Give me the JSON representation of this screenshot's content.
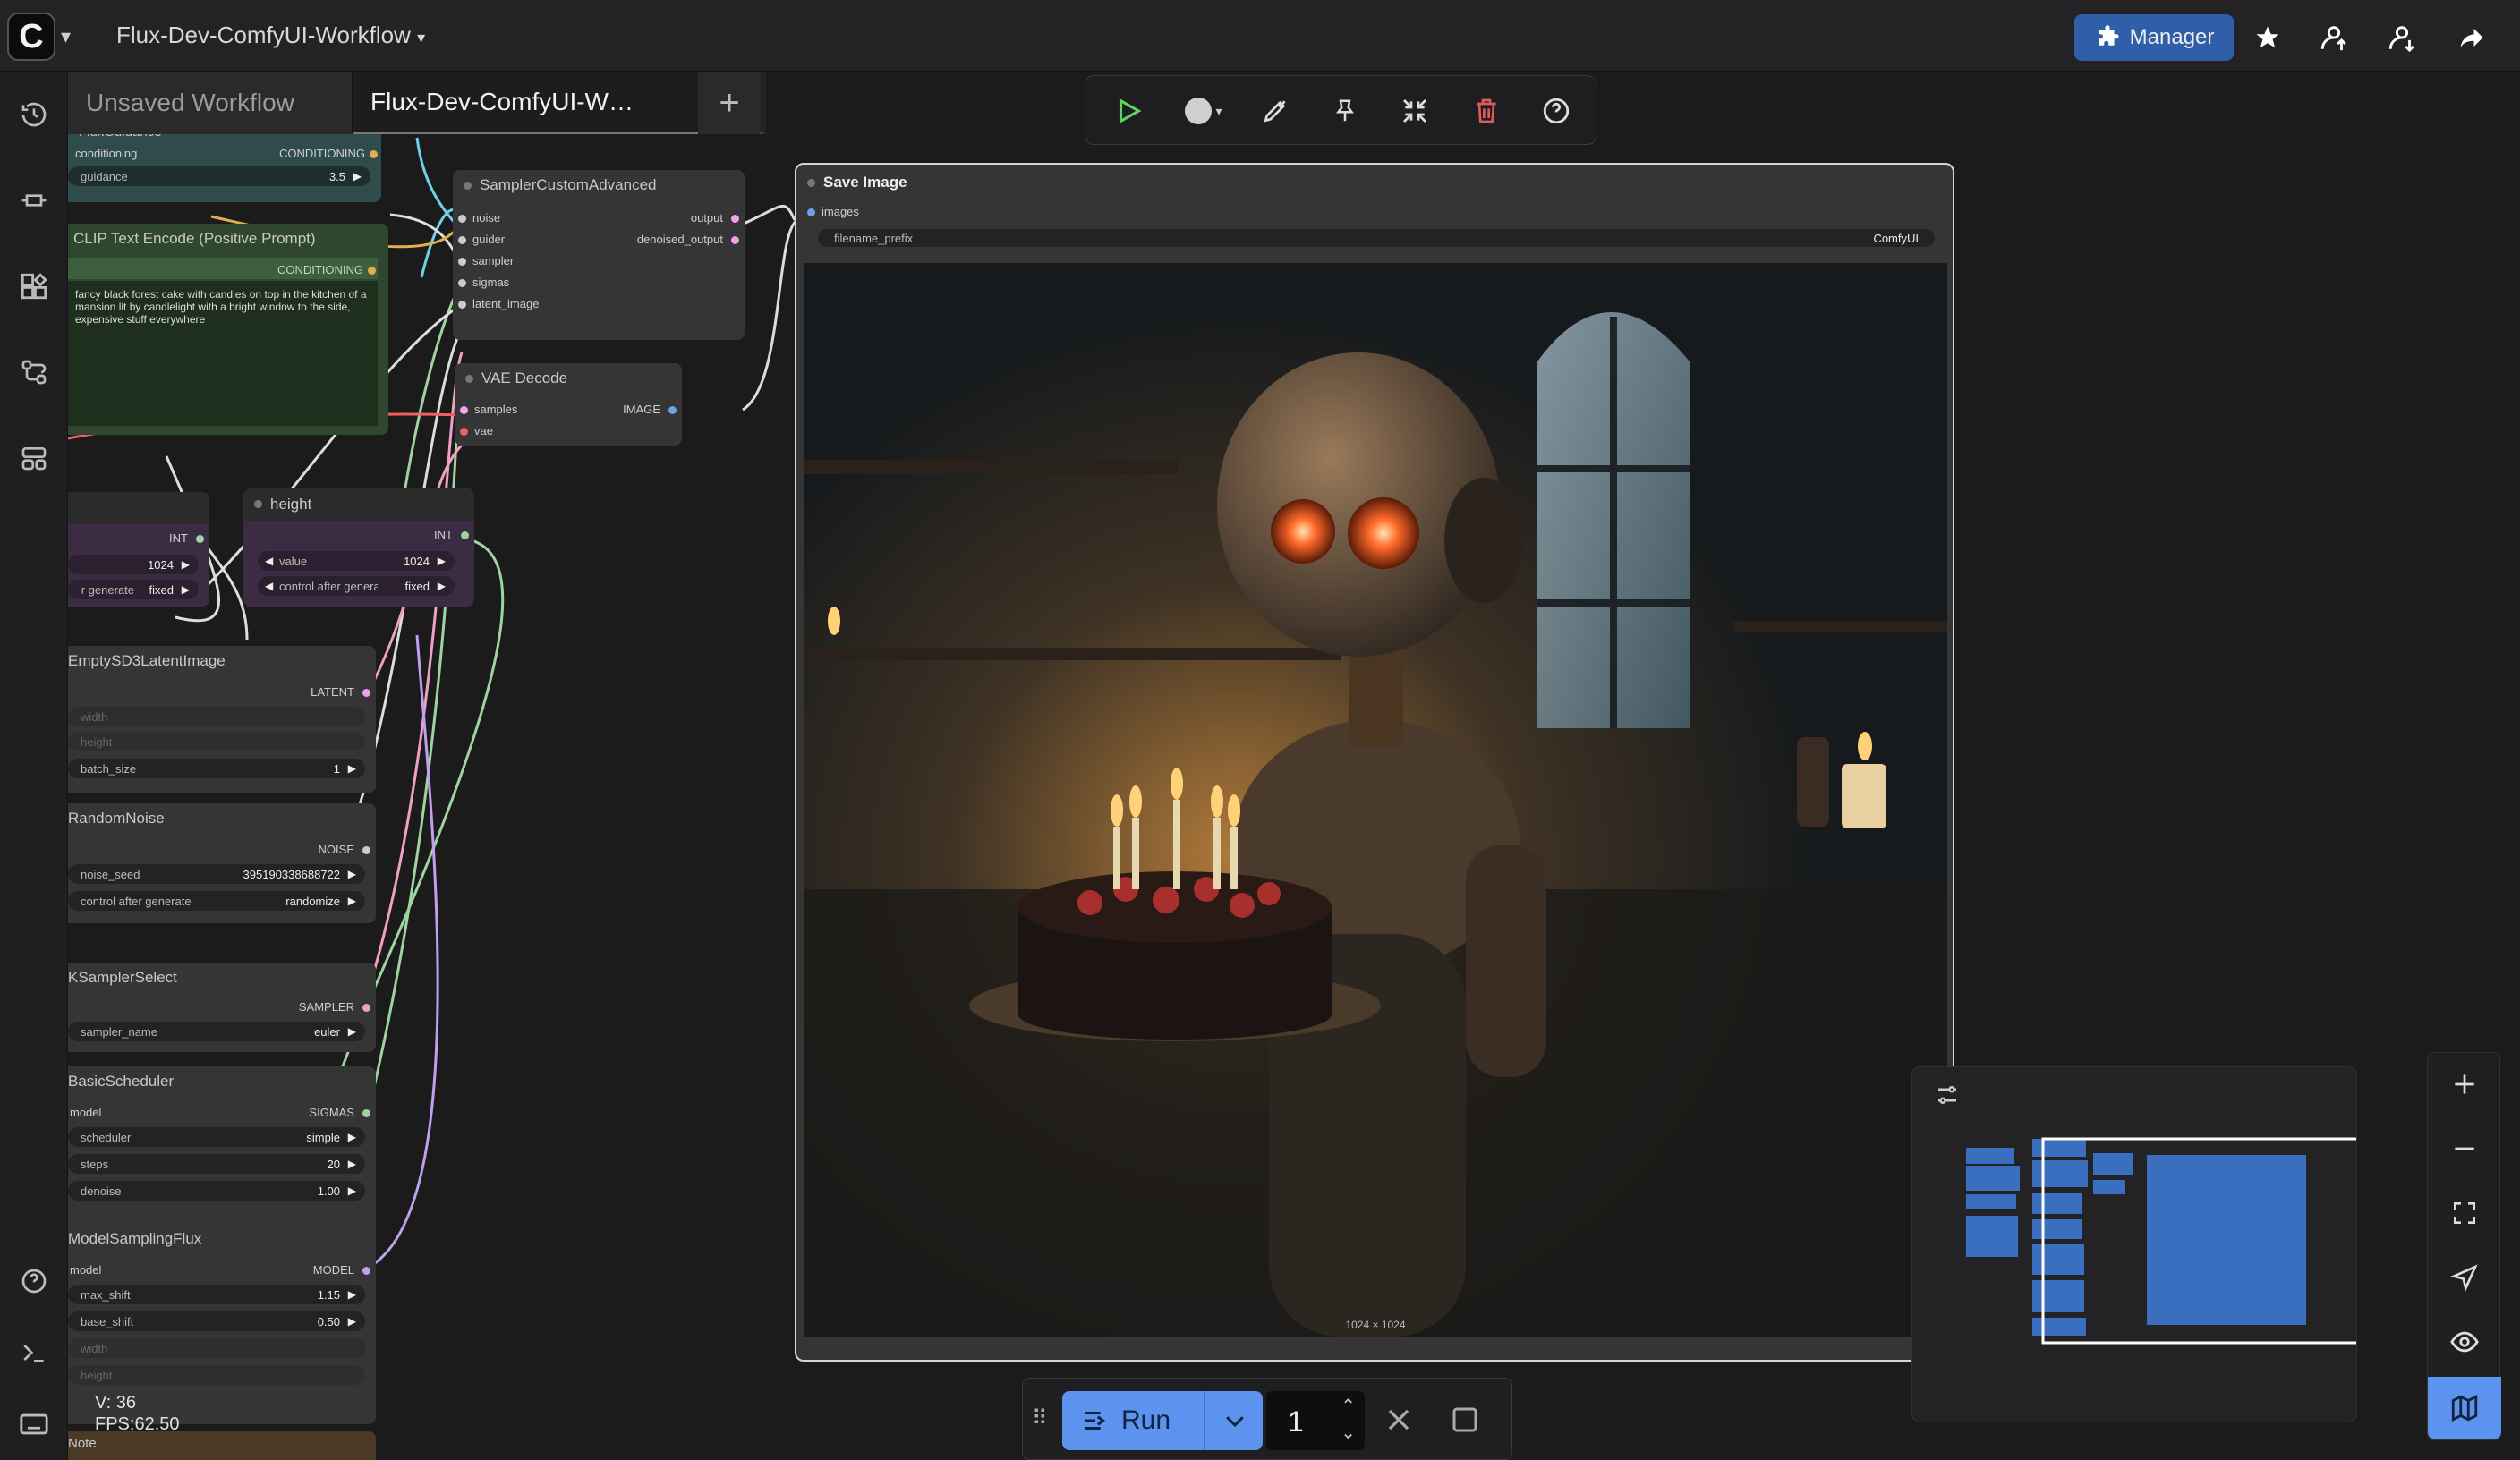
{
  "app": {
    "workflow_title": "Flux-Dev-ComfyUI-Workflow"
  },
  "topbar": {
    "manager_label": "Manager"
  },
  "tabs": [
    {
      "label": "Unsaved Workflow"
    },
    {
      "label": "Flux-Dev-ComfyUI-W…"
    }
  ],
  "nodes": {
    "flux_guidance": {
      "title": "FluxGuidance",
      "input": "conditioning",
      "output": "CONDITIONING",
      "widget_label": "guidance",
      "widget_value": "3.5"
    },
    "clip_encode": {
      "title": "CLIP Text Encode (Positive Prompt)",
      "output": "CONDITIONING",
      "text": "fancy black forest cake with candles on top in the kitchen of a mansion lit by candlelight with a bright window to the side, expensive stuff everywhere"
    },
    "sampler_custom": {
      "title": "SamplerCustomAdvanced",
      "inputs": [
        "noise",
        "guider",
        "sampler",
        "sigmas",
        "latent_image"
      ],
      "outputs": [
        "output",
        "denoised_output"
      ]
    },
    "vae_decode": {
      "title": "VAE Decode",
      "inputs": [
        "samples",
        "vae"
      ],
      "output": "IMAGE"
    },
    "width": {
      "output": "INT",
      "value": "1024",
      "control_label": "control after generate",
      "control_value": "fixed"
    },
    "height": {
      "title": "height",
      "output": "INT",
      "value_label": "value",
      "value": "1024",
      "control_label": "control after generate",
      "control_value": "fixed"
    },
    "empty_latent": {
      "title": "EmptySD3LatentImage",
      "output": "LATENT",
      "w1": "width",
      "w2": "height",
      "w3_label": "batch_size",
      "w3_value": "1"
    },
    "random_noise": {
      "title": "RandomNoise",
      "output": "NOISE",
      "seed_label": "noise_seed",
      "seed_value": "395190338688722",
      "control_label": "control after generate",
      "control_value": "randomize"
    },
    "ksampler_select": {
      "title": "KSamplerSelect",
      "output": "SAMPLER",
      "label": "sampler_name",
      "value": "euler"
    },
    "basic_scheduler": {
      "title": "BasicScheduler",
      "input": "model",
      "output": "SIGMAS",
      "scheduler_label": "scheduler",
      "scheduler_value": "simple",
      "steps_label": "steps",
      "steps_value": "20",
      "denoise_label": "denoise",
      "denoise_value": "1.00"
    },
    "model_sampling": {
      "title": "ModelSamplingFlux",
      "input": "model",
      "output": "MODEL",
      "max_shift_label": "max_shift",
      "max_shift_value": "1.15",
      "base_shift_label": "base_shift",
      "base_shift_value": "0.50",
      "w1": "width",
      "w2": "height"
    },
    "note": {
      "title": "Note"
    },
    "save_image": {
      "title": "Save Image",
      "input": "images",
      "prefix_label": "filename_prefix",
      "prefix_value": "ComfyUI",
      "image_size": "1024 × 1024"
    }
  },
  "stats": {
    "vertices": "V: 36",
    "fps": "FPS:62.50"
  },
  "runbar": {
    "run_label": "Run",
    "batch_count": "1"
  },
  "colors": {
    "accent": "#5b93ef",
    "manager": "#2f5fa8",
    "run_green": "#5fd35f",
    "delete_red": "#e05a5a",
    "wire_conditioning": "#e0b04a",
    "wire_vae": "#f06060",
    "wire_int": "#9fd4a0"
  },
  "icons": [
    "comfy-logo-icon",
    "history-icon",
    "node-library-icon",
    "model-library-icon",
    "workflows-icon",
    "templates-icon",
    "help-icon",
    "console-icon",
    "keyboard-icon",
    "star-icon",
    "share-icon",
    "play-icon",
    "record-icon",
    "pen-icon",
    "pin-icon",
    "collapse-icon",
    "trash-icon",
    "question-icon",
    "zoom-in-icon",
    "zoom-out-icon",
    "fit-view-icon",
    "locate-icon",
    "eye-icon",
    "map-icon",
    "filter-icon"
  ]
}
